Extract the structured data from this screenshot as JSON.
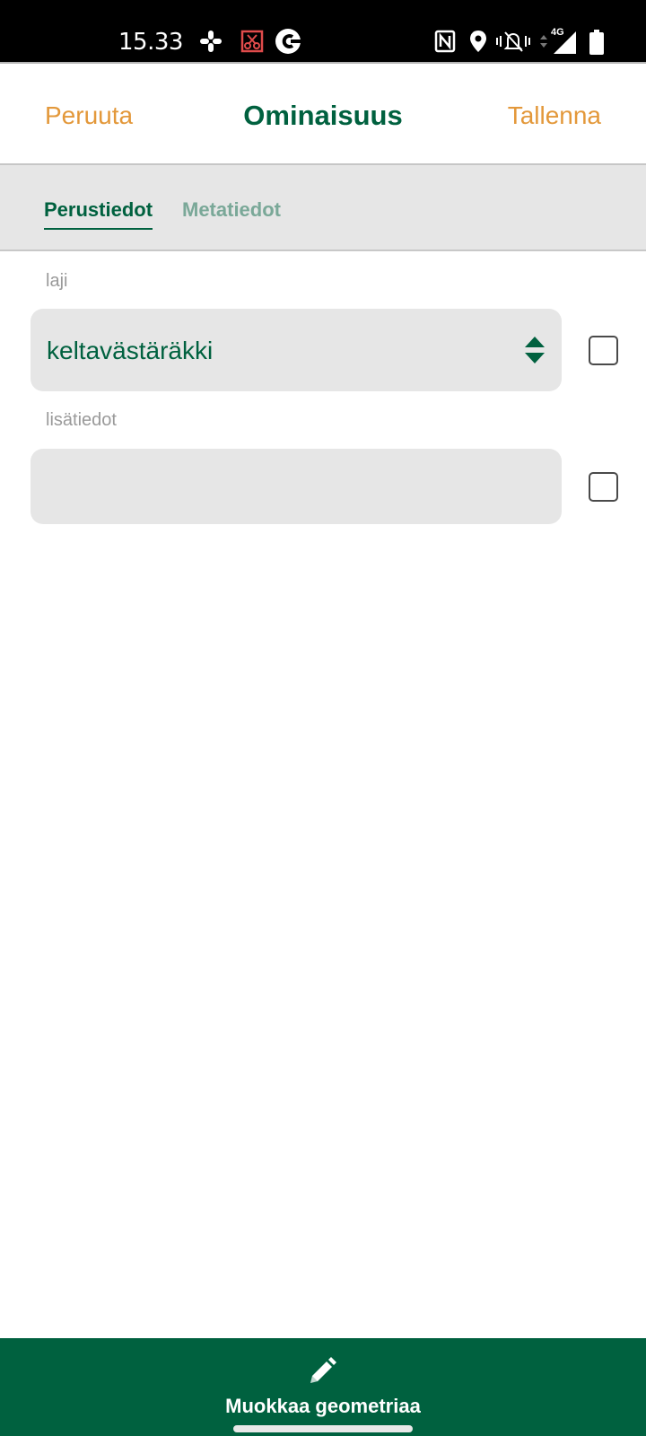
{
  "status_bar": {
    "time": "15.33",
    "network_label": "4G",
    "icons": [
      "slack-icon",
      "screenshot-disabled-icon",
      "c-app-icon",
      "nfc-icon",
      "location-icon",
      "vibrate-icon",
      "data-arrows-icon",
      "signal-icon",
      "battery-icon"
    ]
  },
  "header": {
    "cancel_label": "Peruuta",
    "title": "Ominaisuus",
    "save_label": "Tallenna"
  },
  "tabs": [
    {
      "label": "Perustiedot",
      "active": true
    },
    {
      "label": "Metatiedot",
      "active": false
    }
  ],
  "form": {
    "fields": [
      {
        "label": "laji",
        "type": "select",
        "value": "keltavästäräkki",
        "checked": false
      },
      {
        "label": "lisätiedot",
        "type": "text",
        "value": "",
        "checked": false
      }
    ]
  },
  "bottom_bar": {
    "label": "Muokkaa geometriaa",
    "icon": "pencil-icon"
  },
  "colors": {
    "accent_green": "#00613f",
    "action_orange": "#e3983a",
    "field_bg": "#e6e6e6"
  }
}
